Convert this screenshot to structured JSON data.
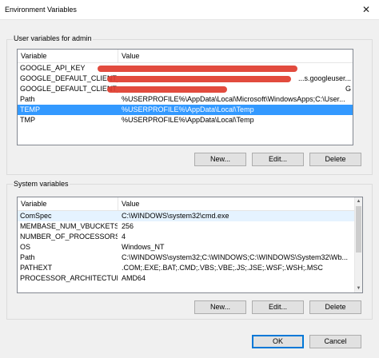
{
  "window": {
    "title": "Environment Variables",
    "close_glyph": "✕"
  },
  "user_vars": {
    "group_label": "User variables for admin",
    "columns": {
      "variable": "Variable",
      "value": "Value"
    },
    "rows": [
      {
        "variable": "GOOGLE_API_KEY",
        "value": "",
        "redacted": true
      },
      {
        "variable": "GOOGLE_DEFAULT_CLIENT_ID",
        "value": "...s.googleuser...",
        "redacted": true
      },
      {
        "variable": "GOOGLE_DEFAULT_CLIENT_...",
        "value": "G",
        "redacted": true
      },
      {
        "variable": "Path",
        "value": "%USERPROFILE%\\AppData\\Local\\Microsoft\\WindowsApps;C:\\User..."
      },
      {
        "variable": "TEMP",
        "value": "%USERPROFILE%\\AppData\\Local\\Temp",
        "selected": true
      },
      {
        "variable": "TMP",
        "value": "%USERPROFILE%\\AppData\\Local\\Temp"
      }
    ],
    "buttons": {
      "new": "New...",
      "edit": "Edit...",
      "delete": "Delete"
    }
  },
  "system_vars": {
    "group_label": "System variables",
    "columns": {
      "variable": "Variable",
      "value": "Value"
    },
    "rows": [
      {
        "variable": "ComSpec",
        "value": "C:\\WINDOWS\\system32\\cmd.exe"
      },
      {
        "variable": "MEMBASE_NUM_VBUCKETS",
        "value": "256"
      },
      {
        "variable": "NUMBER_OF_PROCESSORS",
        "value": "4"
      },
      {
        "variable": "OS",
        "value": "Windows_NT"
      },
      {
        "variable": "Path",
        "value": "C:\\WINDOWS\\system32;C:\\WINDOWS;C:\\WINDOWS\\System32\\Wb..."
      },
      {
        "variable": "PATHEXT",
        "value": ".COM;.EXE;.BAT;.CMD;.VBS;.VBE;.JS;.JSE;.WSF;.WSH;.MSC"
      },
      {
        "variable": "PROCESSOR_ARCHITECTURE",
        "value": "AMD64"
      }
    ],
    "buttons": {
      "new": "New...",
      "edit": "Edit...",
      "delete": "Delete"
    }
  },
  "dialog_buttons": {
    "ok": "OK",
    "cancel": "Cancel"
  },
  "colors": {
    "selection": "#3399ff",
    "redaction": "#e03c2e"
  }
}
